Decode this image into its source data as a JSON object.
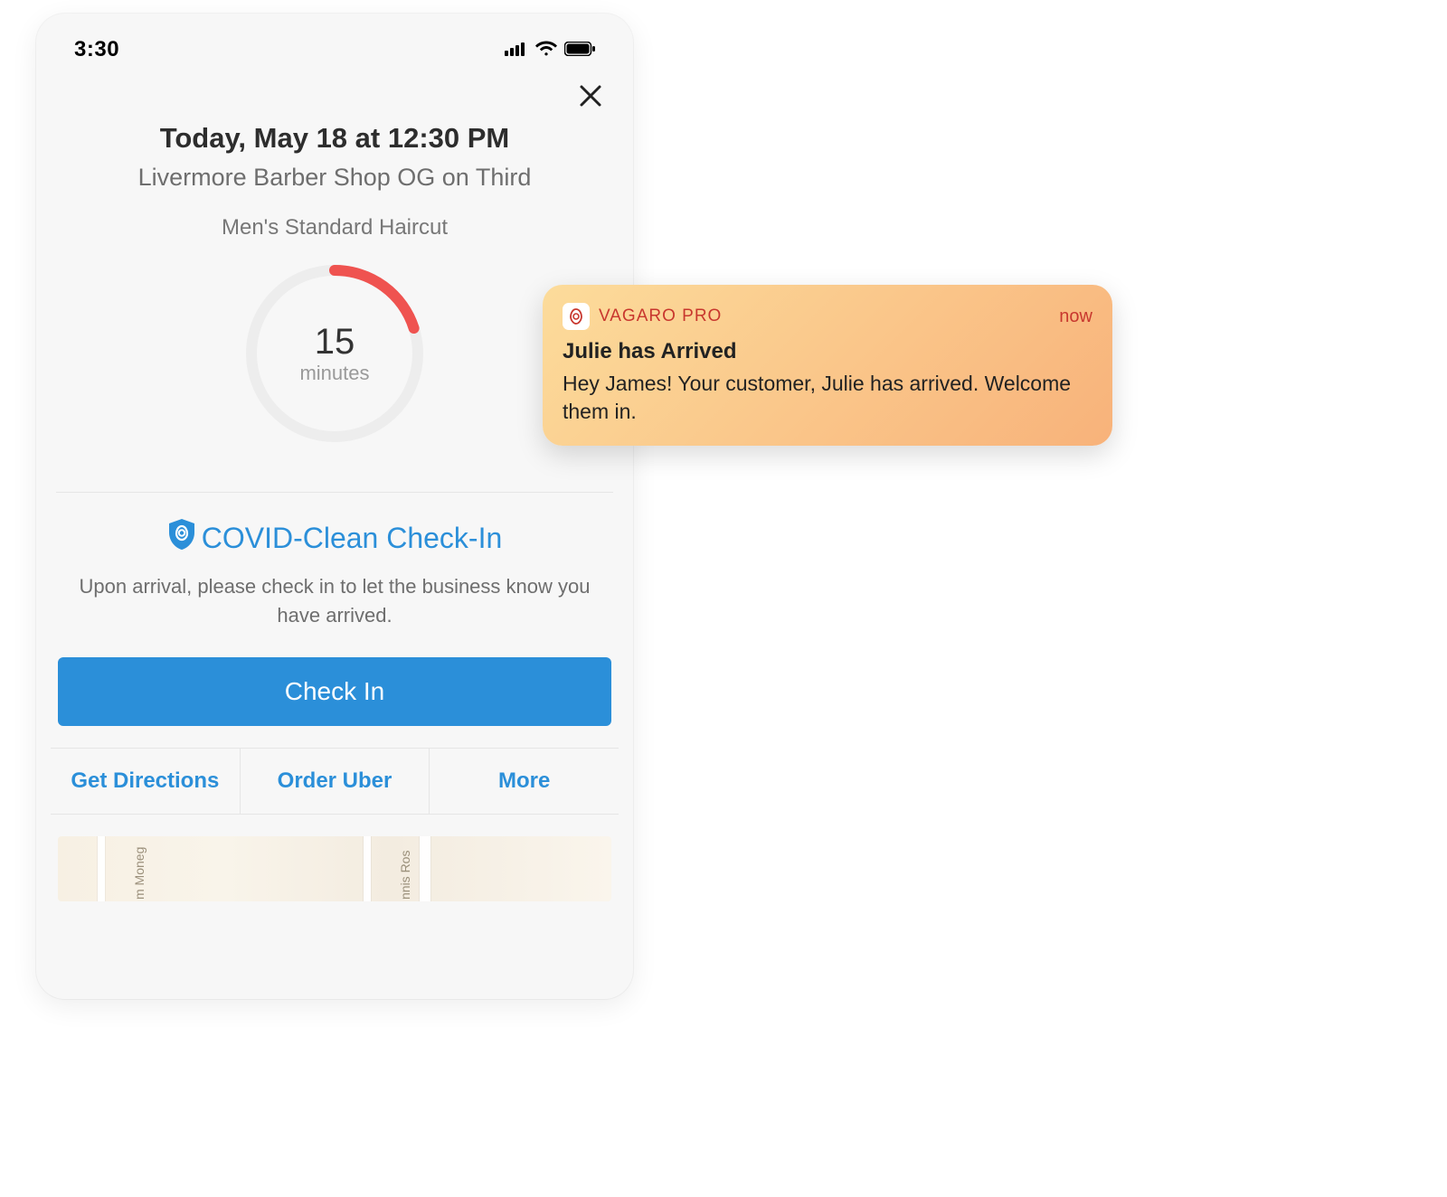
{
  "statusbar": {
    "time": "3:30"
  },
  "appointment": {
    "date_line": "Today, May 18 at 12:30 PM",
    "shop_name": "Livermore Barber Shop OG on Third",
    "service_name": "Men's Standard Haircut",
    "countdown_value": "15",
    "countdown_unit": "minutes",
    "progress_fraction": 0.2
  },
  "covid": {
    "heading": "COVID-Clean Check-In",
    "description": "Upon arrival, please check in to let the business know you have arrived.",
    "button_label": "Check In"
  },
  "actions": {
    "directions": "Get Directions",
    "uber": "Order Uber",
    "more": "More"
  },
  "map": {
    "label_left": "m Moneg",
    "label_right": "nnis Ros"
  },
  "notification": {
    "app_name": "VAGARO PRO",
    "time_label": "now",
    "title": "Julie has Arrived",
    "body": "Hey James! Your customer, Julie has arrived. Welcome them in."
  },
  "colors": {
    "accent_blue": "#2b8fd9",
    "ring_red": "#ef5350"
  }
}
